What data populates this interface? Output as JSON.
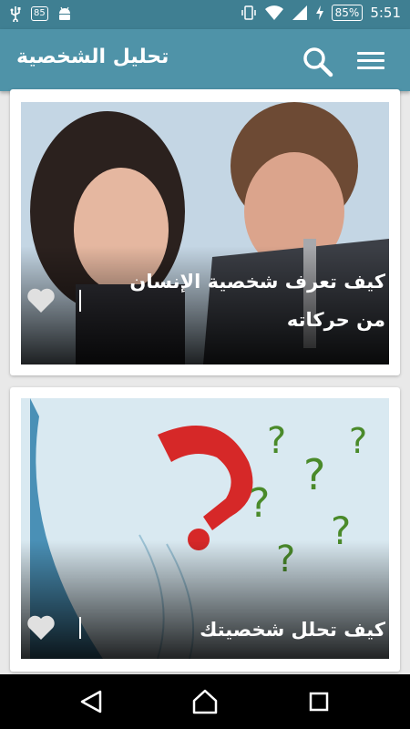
{
  "status_bar": {
    "time": "5:51",
    "battery": "85%",
    "notif_badge": "85",
    "icons": [
      "usb-icon",
      "notification-badge-icon",
      "android-icon",
      "vibrate-icon",
      "wifi-icon",
      "cell-signal-icon",
      "charging-icon",
      "battery-icon"
    ]
  },
  "app_bar": {
    "title": "تحليل الشخصية",
    "icons": [
      "search-icon",
      "menu-icon"
    ]
  },
  "cards": [
    {
      "title": "كيف تعرف شخصية الإنسان من حركاته",
      "icon": "heart-icon"
    },
    {
      "title": "كيف تحلل شخصيتك",
      "icon": "heart-icon"
    }
  ],
  "nav_bar": {
    "icons": [
      "back-icon",
      "home-icon",
      "recents-icon"
    ]
  },
  "colors": {
    "status_bar": "#3f7f92",
    "app_bar": "#4f93a8",
    "background": "#e9e9e9"
  }
}
